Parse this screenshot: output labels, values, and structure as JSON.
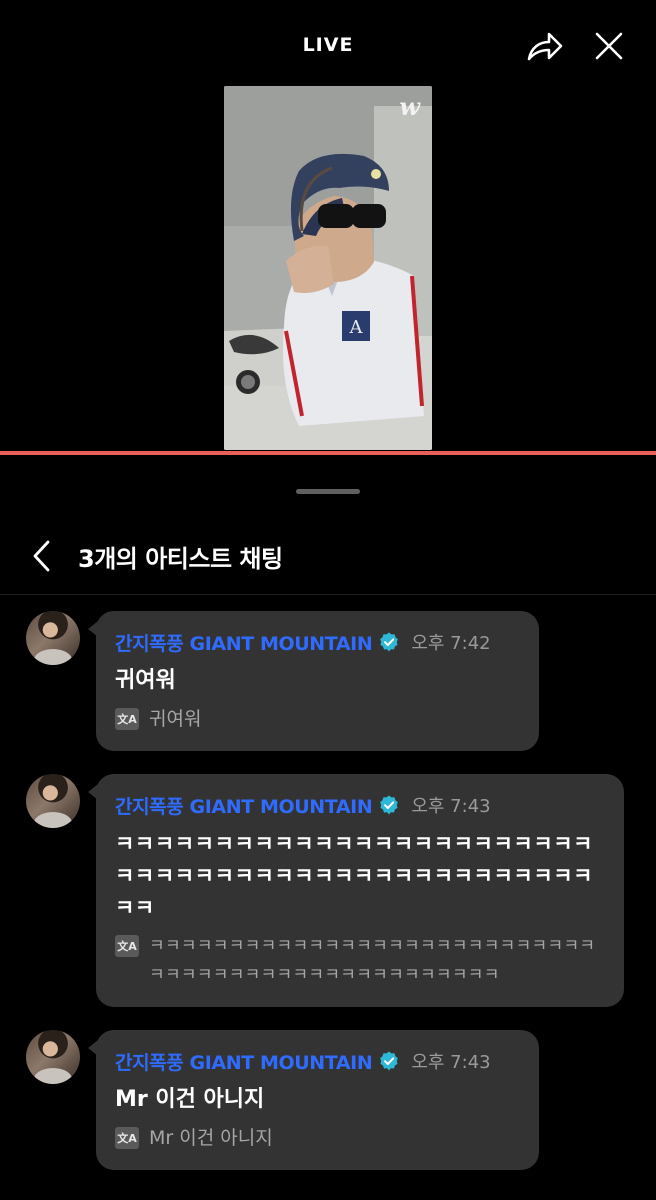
{
  "header": {
    "title": "LIVE"
  },
  "video": {
    "logo": "w",
    "progress": 1.0
  },
  "chat": {
    "title": "3개의 아티스트 채팅",
    "messages": [
      {
        "sender": "간지폭풍 GIANT MOUNTAIN",
        "time": "오후 7:42",
        "text": "귀여워",
        "translation": "귀여워"
      },
      {
        "sender": "간지폭풍 GIANT MOUNTAIN",
        "time": "오후 7:43",
        "text": "ㅋㅋㅋㅋㅋㅋㅋㅋㅋㅋㅋㅋㅋㅋㅋㅋㅋㅋㅋㅋㅋㅋㅋㅋㅋㅋㅋㅋㅋㅋㅋㅋㅋㅋㅋㅋㅋㅋㅋㅋㅋㅋㅋㅋㅋㅋㅋㅋㅋㅋ",
        "translation": "ㅋㅋㅋㅋㅋㅋㅋㅋㅋㅋㅋㅋㅋㅋㅋㅋㅋㅋㅋㅋㅋㅋㅋㅋㅋㅋㅋㅋㅋㅋㅋㅋㅋㅋㅋㅋㅋㅋㅋㅋㅋㅋㅋㅋㅋㅋㅋㅋㅋㅋ"
      },
      {
        "sender": "간지폭풍 GIANT MOUNTAIN",
        "time": "오후 7:43",
        "text": "Mr 이건 아니지",
        "translation": "Mr 이건 아니지"
      }
    ]
  },
  "colors": {
    "accent": "#2f6bff",
    "verified": "#2fb7d6",
    "progress": "#e9605a",
    "bubble": "#333333"
  },
  "icons": {
    "share": "share-arrow-icon",
    "close": "close-icon",
    "back": "chevron-left-icon",
    "verified": "verified-badge-icon",
    "translate": "translate-icon"
  }
}
